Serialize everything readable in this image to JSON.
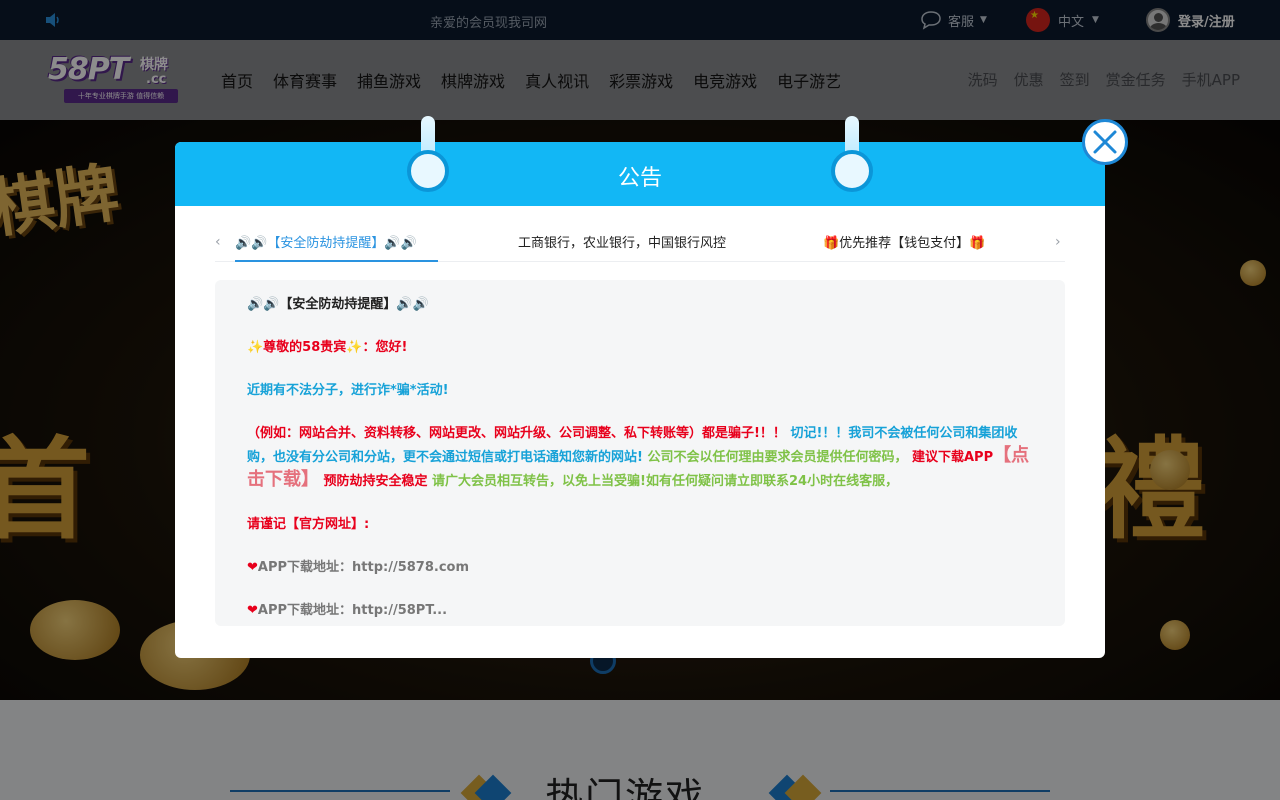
{
  "topbar": {
    "marquee": "亲爱的会员现我司网",
    "kefu": "客服",
    "lang": "中文",
    "login": "登录/注册"
  },
  "logo": {
    "main": "58PT",
    "suffix1": "棋牌",
    "suffix2": ".cc",
    "slogan": "十年专业棋牌手游 值得信赖"
  },
  "nav": [
    "首页",
    "体育赛事",
    "捕鱼游戏",
    "棋牌游戏",
    "真人视讯",
    "彩票游戏",
    "电竞游戏",
    "电子游艺"
  ],
  "nav_right": [
    "洗码",
    "优惠",
    "签到",
    "赏金任务",
    "手机APP"
  ],
  "banner": {
    "left_text": "棋牌",
    "big_left": "首",
    "big_right": "禮"
  },
  "hot": {
    "title": "热门游戏"
  },
  "modal": {
    "title": "公告",
    "tabs": [
      "🔊🔊【安全防劫持提醒】🔊🔊",
      "工商银行，农业银行，中国银行风控",
      "🎁优先推荐【钱包支付】🎁"
    ],
    "content": {
      "heading": "🔊🔊【安全防劫持提醒】🔊🔊",
      "greeting": "✨尊敬的58贵宾✨：您好!",
      "warning": "近期有不法分子，进行诈*骗*活动!",
      "p3_red": "（例如：网站合并、资料转移、网站更改、网站升级、公司调整、私下转账等）都是骗子!！！",
      "p3_blue": " 切记!！！我司不会被任何公司和集团收购，也没有分公司和分站，更不会通过短信或打电话通知您新的网站!",
      "p3_green1": " 公司不会以任何理由要求会员提供任何密码，",
      "p3_red2": " 建议下载APP",
      "p3_link": "【点击下载】",
      "p3_red3": " 预防劫持安全稳定",
      "p3_green2": " 请广大会员相互转告，以免上当受骗!如有任何疑问请立即联系24小时在线客服，",
      "remember": "请谨记【官方网址】:",
      "app1": "APP下载地址：http://5878.com",
      "app2": "APP下载地址：http://58PT..."
    }
  }
}
